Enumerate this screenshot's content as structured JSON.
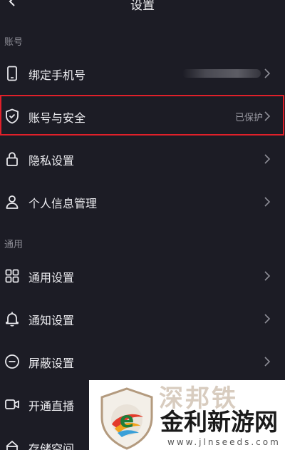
{
  "header": {
    "title": "设置"
  },
  "sections": [
    {
      "label": "账号"
    },
    {
      "label": "通用"
    }
  ],
  "account_items": [
    {
      "label": "绑定手机号",
      "value": "",
      "icon": "phone-icon"
    },
    {
      "label": "账号与安全",
      "value": "已保护",
      "icon": "shield-icon"
    },
    {
      "label": "隐私设置",
      "value": "",
      "icon": "lock-icon"
    },
    {
      "label": "个人信息管理",
      "value": "",
      "icon": "person-icon"
    }
  ],
  "general_items": [
    {
      "label": "通用设置",
      "icon": "grid-icon"
    },
    {
      "label": "通知设置",
      "icon": "bell-icon"
    },
    {
      "label": "屏蔽设置",
      "icon": "block-icon"
    },
    {
      "label": "开通直播",
      "icon": "video-icon"
    },
    {
      "label": "存储空间",
      "icon": "storage-icon"
    }
  ],
  "watermark": {
    "ghost_text": "深邦铁",
    "name": "金利新游网",
    "url": "www.jlnseeds.com"
  },
  "colors": {
    "background": "#1c1c25",
    "highlight_border": "#e0202a",
    "secondary_text": "#9a9aa3"
  }
}
